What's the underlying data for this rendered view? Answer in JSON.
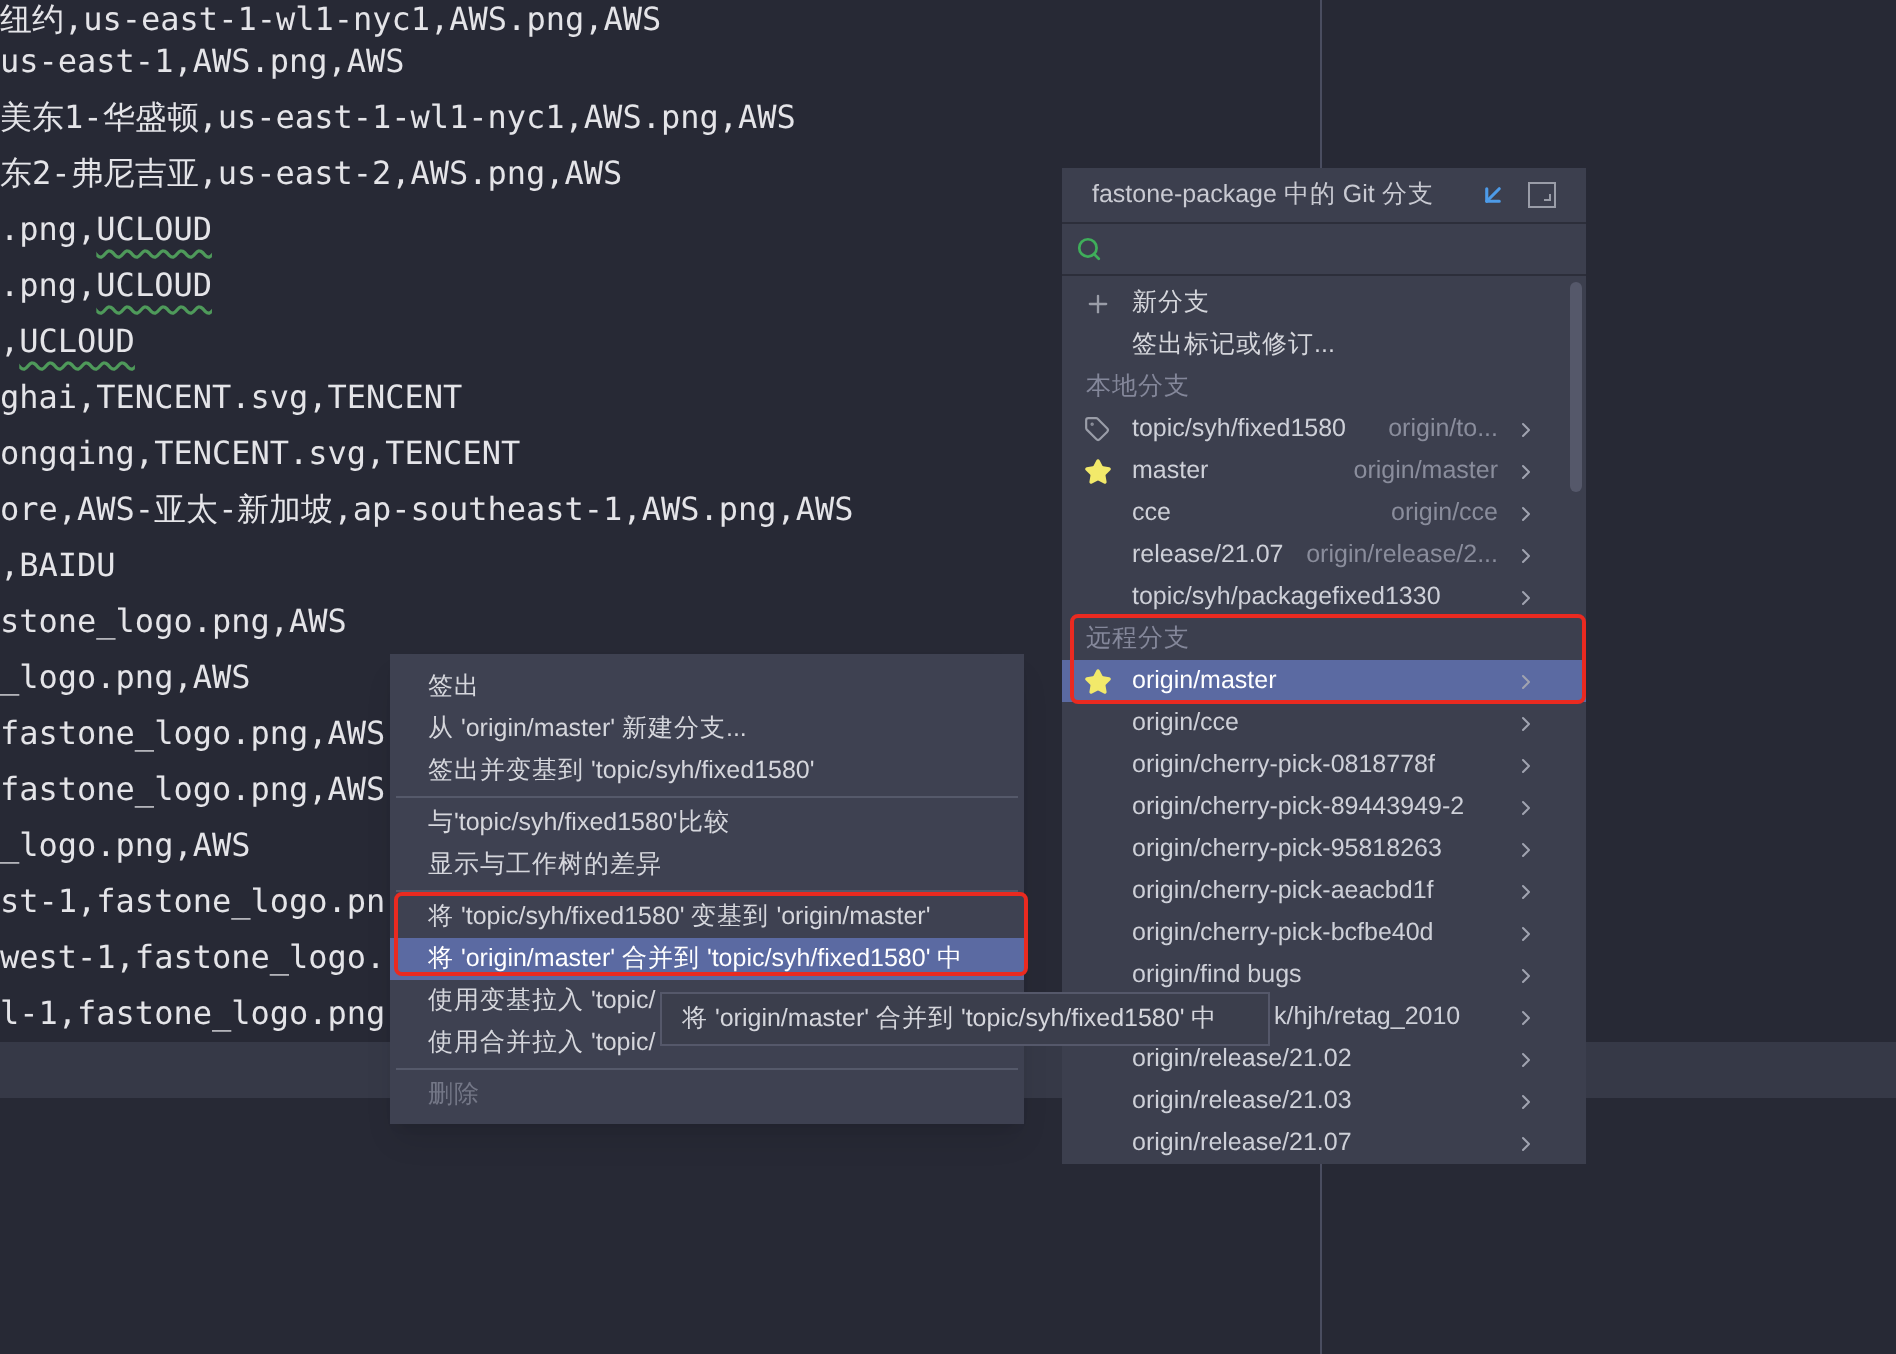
{
  "editor": {
    "lines": [
      {
        "parts": [
          {
            "text": "纽约,us-east-1-wl1-nyc1,AWS.png,AWS"
          }
        ]
      },
      {
        "parts": [
          {
            "text": "us-east-1,AWS.png,AWS"
          }
        ]
      },
      {
        "parts": [
          {
            "text": "美东1-华盛顿,us-east-1-wl1-nyc1,AWS.png,AWS"
          }
        ]
      },
      {
        "parts": [
          {
            "text": "东2-弗尼吉亚,us-east-2,AWS.png,AWS"
          }
        ]
      },
      {
        "parts": [
          {
            "text": ".png,"
          },
          {
            "text": "UCLOUD",
            "squiggly": true
          }
        ]
      },
      {
        "parts": [
          {
            "text": ".png,"
          },
          {
            "text": "UCLOUD",
            "squiggly": true
          }
        ]
      },
      {
        "parts": [
          {
            "text": ","
          },
          {
            "text": "UCLOUD",
            "squiggly": true
          }
        ]
      },
      {
        "parts": [
          {
            "text": "ghai,TENCENT.svg,TENCENT"
          }
        ]
      },
      {
        "parts": [
          {
            "text": "ongqing,TENCENT.svg,TENCENT"
          }
        ]
      },
      {
        "parts": [
          {
            "text": "ore,AWS-亚太-新加坡,ap-southeast-1,AWS.png,AWS"
          }
        ]
      },
      {
        "parts": [
          {
            "text": ",BAIDU"
          }
        ]
      },
      {
        "parts": [
          {
            "text": "stone_logo.png,AWS"
          }
        ]
      },
      {
        "parts": [
          {
            "text": "_logo.png,AWS"
          }
        ]
      },
      {
        "parts": [
          {
            "text": "fastone_logo.png,AWS"
          }
        ]
      },
      {
        "parts": [
          {
            "text": "fastone_logo.png,AWS"
          }
        ]
      },
      {
        "parts": [
          {
            "text": "_logo.png,AWS"
          }
        ]
      },
      {
        "parts": [
          {
            "text": "st-1,fastone_logo.pn"
          }
        ]
      },
      {
        "parts": [
          {
            "text": "west-1,fastone_logo."
          }
        ]
      },
      {
        "parts": [
          {
            "text": "l-1,fastone_logo.png"
          }
        ]
      }
    ]
  },
  "context_menu": {
    "groups": [
      [
        {
          "label": "签出",
          "selected": false,
          "disabled": false
        },
        {
          "label": "从 'origin/master' 新建分支...",
          "selected": false,
          "disabled": false
        },
        {
          "label": "签出并变基到 'topic/syh/fixed1580'",
          "selected": false,
          "disabled": false
        }
      ],
      [
        {
          "label": "与'topic/syh/fixed1580'比较",
          "selected": false,
          "disabled": false
        },
        {
          "label": "显示与工作树的差异",
          "selected": false,
          "disabled": false
        }
      ],
      [
        {
          "label": "将 'topic/syh/fixed1580' 变基到 'origin/master'",
          "selected": false,
          "disabled": false
        },
        {
          "label": "将 'origin/master' 合并到 'topic/syh/fixed1580' 中",
          "selected": true,
          "disabled": false
        },
        {
          "label": "使用变基拉入 'topic/",
          "selected": false,
          "disabled": false
        },
        {
          "label": "使用合并拉入 'topic/",
          "selected": false,
          "disabled": false
        }
      ],
      [
        {
          "label": "删除",
          "selected": false,
          "disabled": true
        }
      ]
    ]
  },
  "tooltip": {
    "text": "将 'origin/master' 合并到 'topic/syh/fixed1580' 中"
  },
  "branch_popup": {
    "title": "fastone-package 中的 Git 分支",
    "actions": [
      {
        "label": "新分支",
        "kind": "new"
      },
      {
        "label": "签出标记或修订...",
        "kind": "plain"
      }
    ],
    "sections": [
      {
        "title": "本地分支",
        "items": [
          {
            "name": "topic/syh/fixed1580",
            "tracking": "origin/to...",
            "kind": "tagged",
            "selected": false
          },
          {
            "name": "master",
            "tracking": "origin/master",
            "kind": "favorite",
            "selected": false
          },
          {
            "name": "cce",
            "tracking": "origin/cce",
            "kind": "plain",
            "selected": false
          },
          {
            "name": "release/21.07",
            "tracking": "origin/release/2...",
            "kind": "plain",
            "selected": false
          },
          {
            "name": "topic/syh/packagefixed1330",
            "kind": "plain",
            "selected": false
          }
        ]
      },
      {
        "title": "远程分支",
        "items": [
          {
            "name": "origin/master",
            "kind": "favorite",
            "selected": true
          },
          {
            "name": "origin/cce",
            "kind": "plain",
            "selected": false
          },
          {
            "name": "origin/cherry-pick-0818778f",
            "kind": "plain",
            "selected": false
          },
          {
            "name": "origin/cherry-pick-89443949-2",
            "kind": "plain",
            "selected": false
          },
          {
            "name": "origin/cherry-pick-95818263",
            "kind": "plain",
            "selected": false
          },
          {
            "name": "origin/cherry-pick-aeacbd1f",
            "kind": "plain",
            "selected": false
          },
          {
            "name": "origin/cherry-pick-bcfbe40d",
            "kind": "plain",
            "selected": false
          },
          {
            "name": "origin/find bugs",
            "kind": "plain",
            "selected": false
          },
          {
            "name": "k/hjh/retag_2010",
            "kind": "covered",
            "selected": false
          },
          {
            "name": "origin/release/21.02",
            "kind": "plain",
            "selected": false
          },
          {
            "name": "origin/release/21.03",
            "kind": "plain",
            "selected": false
          },
          {
            "name": "origin/release/21.07",
            "kind": "plain",
            "selected": false
          }
        ]
      }
    ]
  }
}
